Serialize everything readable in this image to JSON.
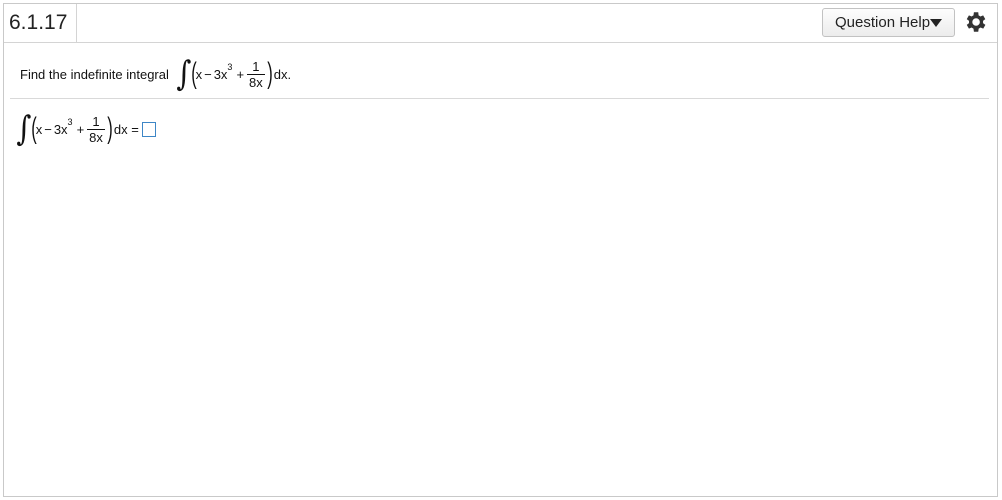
{
  "header": {
    "question_number": "6.1.17",
    "help_label": "Question Help"
  },
  "prompt": {
    "text": "Find the indefinite integral",
    "suffix": "dx."
  },
  "integrand": {
    "term1": "x",
    "minus": "−",
    "term2": "3x",
    "power": "3",
    "plus": "+",
    "frac_num": "1",
    "frac_den": "8x"
  },
  "answer": {
    "suffix": "dx =",
    "value": ""
  },
  "icons": {
    "help_dropdown": "triangle-down-icon",
    "settings": "gear-icon"
  },
  "colors": {
    "answer_box_border": "#3d86c6"
  }
}
